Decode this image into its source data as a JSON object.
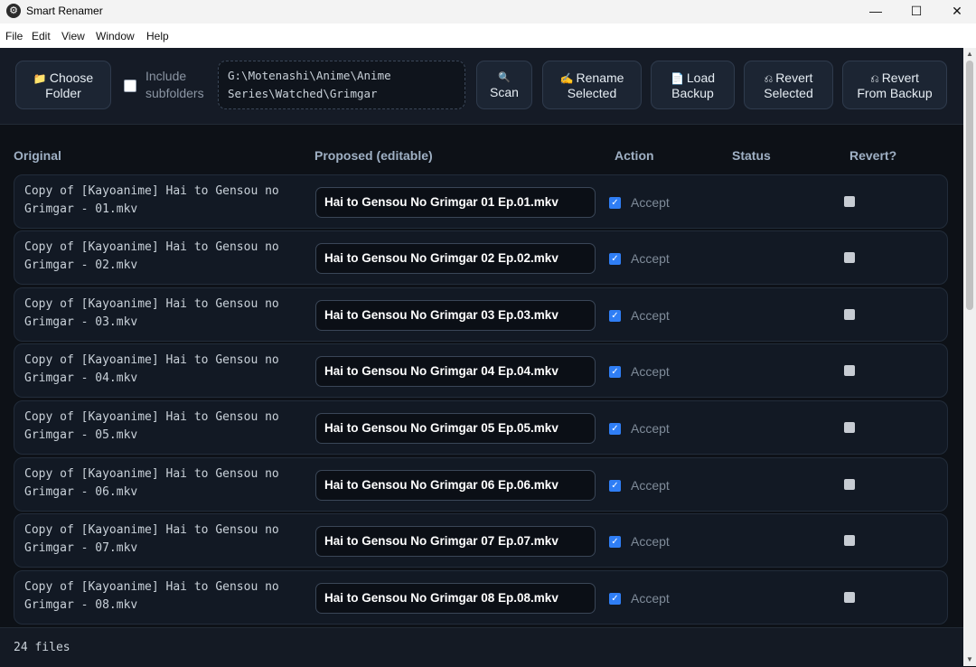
{
  "window": {
    "title": "Smart Renamer",
    "minimize_icon": "—",
    "maximize_icon": "☐",
    "close_icon": "✕"
  },
  "menu": [
    "File",
    "Edit",
    "View",
    "Window",
    "Help"
  ],
  "toolbar": {
    "choose_folder": {
      "icon": "📁",
      "line1": "Choose",
      "line2": "Folder"
    },
    "include_subfolders_line1": "Include",
    "include_subfolders_line2": "subfolders",
    "path_line1": "G:\\Motenashi\\Anime\\Anime",
    "path_line2": "Series\\Watched\\Grimgar",
    "scan": {
      "icon": "🔍",
      "label": "Scan"
    },
    "rename_selected": {
      "icon": "✍",
      "line1": "Rename",
      "line2": "Selected"
    },
    "load_backup": {
      "icon": "📄",
      "line1": "Load",
      "line2": "Backup"
    },
    "revert_selected": {
      "icon": "⎌",
      "line1": "Revert",
      "line2": "Selected"
    },
    "revert_from_backup": {
      "icon": "⎌",
      "line1": "Revert",
      "line2": "From Backup"
    }
  },
  "columns": {
    "original": "Original",
    "proposed": "Proposed (editable)",
    "action": "Action",
    "status": "Status",
    "revert": "Revert?"
  },
  "rows": [
    {
      "orig1": "Copy of [Kayoanime] Hai to Gensou no",
      "orig2": "Grimgar - 01.mkv",
      "proposed": "Hai to Gensou No Grimgar 01 Ep.01.mkv",
      "action": "Accept",
      "status": ""
    },
    {
      "orig1": "Copy of [Kayoanime] Hai to Gensou no",
      "orig2": "Grimgar - 02.mkv",
      "proposed": "Hai to Gensou No Grimgar 02 Ep.02.mkv",
      "action": "Accept",
      "status": ""
    },
    {
      "orig1": "Copy of [Kayoanime] Hai to Gensou no",
      "orig2": "Grimgar - 03.mkv",
      "proposed": "Hai to Gensou No Grimgar 03 Ep.03.mkv",
      "action": "Accept",
      "status": ""
    },
    {
      "orig1": "Copy of [Kayoanime] Hai to Gensou no",
      "orig2": "Grimgar - 04.mkv",
      "proposed": "Hai to Gensou No Grimgar 04 Ep.04.mkv",
      "action": "Accept",
      "status": ""
    },
    {
      "orig1": "Copy of [Kayoanime] Hai to Gensou no",
      "orig2": "Grimgar - 05.mkv",
      "proposed": "Hai to Gensou No Grimgar 05 Ep.05.mkv",
      "action": "Accept",
      "status": ""
    },
    {
      "orig1": "Copy of [Kayoanime] Hai to Gensou no",
      "orig2": "Grimgar - 06.mkv",
      "proposed": "Hai to Gensou No Grimgar 06 Ep.06.mkv",
      "action": "Accept",
      "status": ""
    },
    {
      "orig1": "Copy of [Kayoanime] Hai to Gensou no",
      "orig2": "Grimgar - 07.mkv",
      "proposed": "Hai to Gensou No Grimgar 07 Ep.07.mkv",
      "action": "Accept",
      "status": ""
    },
    {
      "orig1": "Copy of [Kayoanime] Hai to Gensou no",
      "orig2": "Grimgar - 08.mkv",
      "proposed": "Hai to Gensou No Grimgar 08 Ep.08.mkv",
      "action": "Accept",
      "status": ""
    }
  ],
  "status_bar": {
    "file_count": "24 files"
  }
}
